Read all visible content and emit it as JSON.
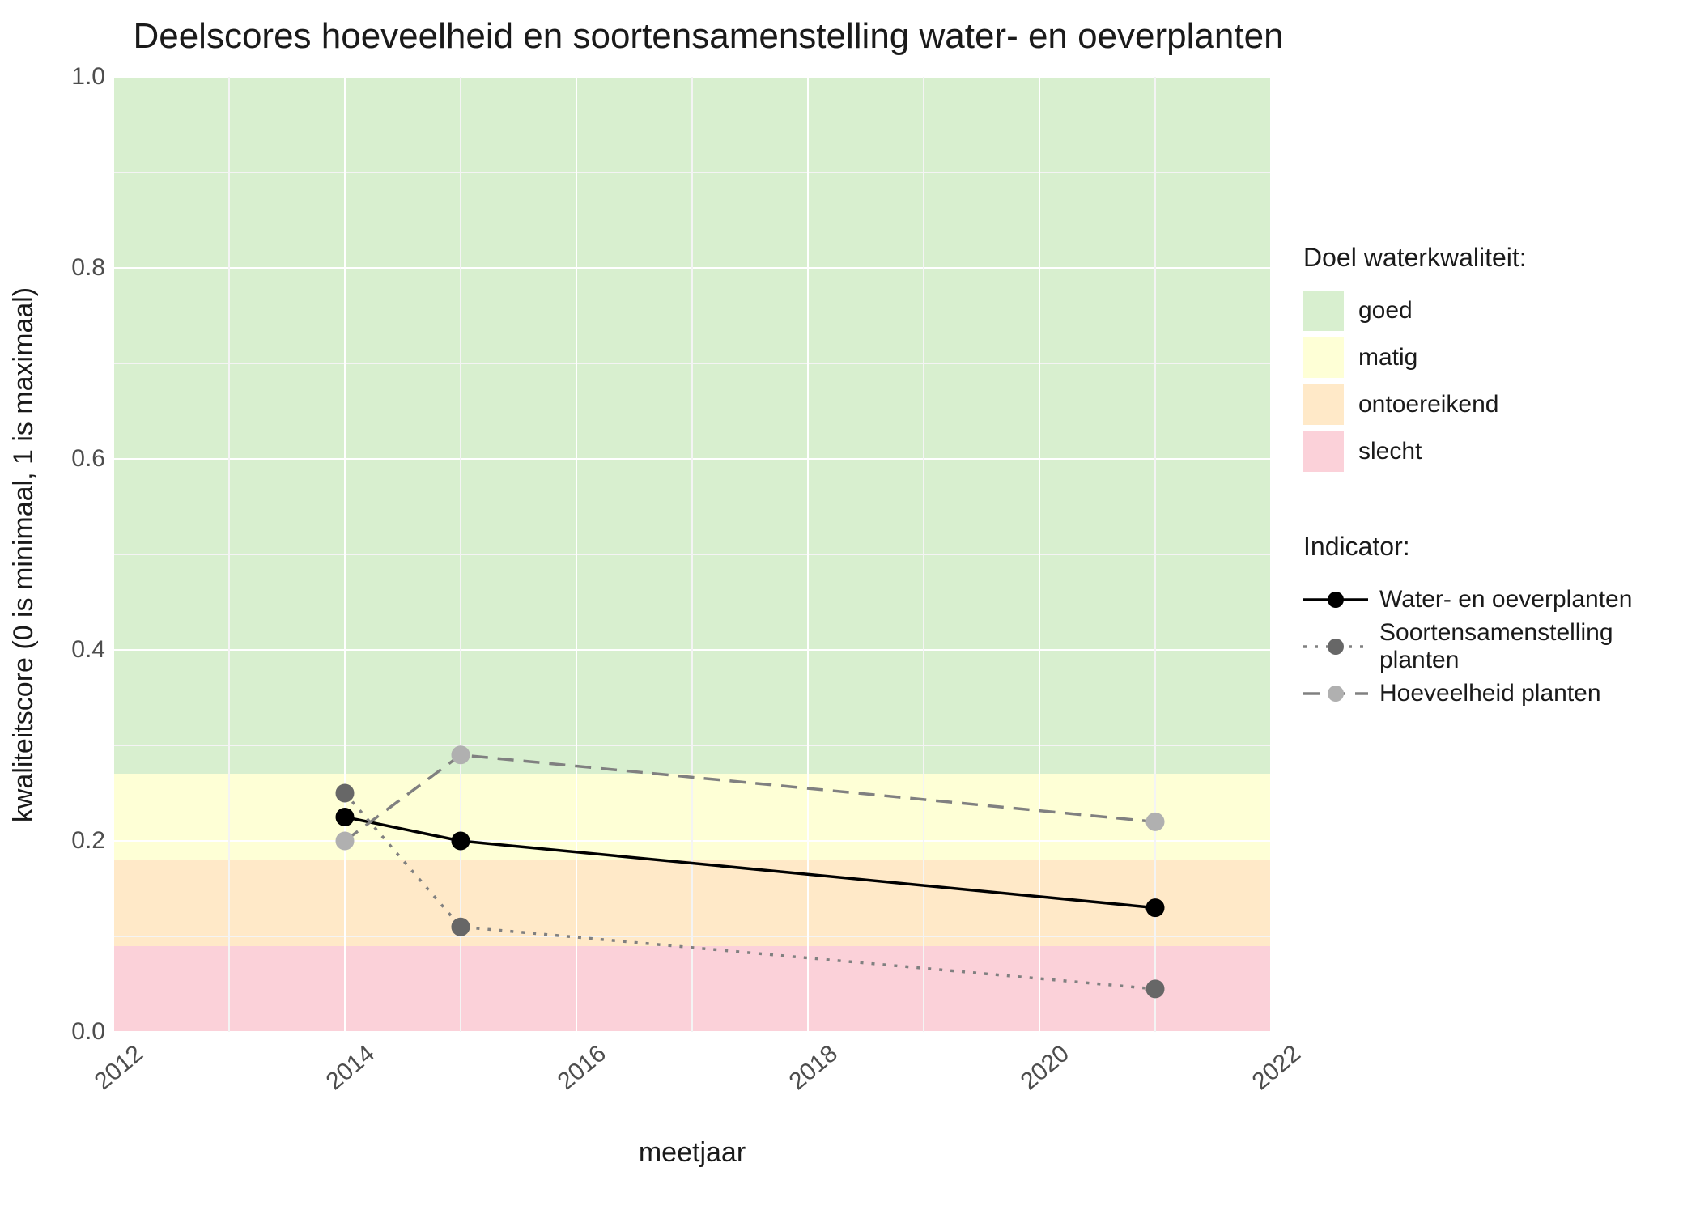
{
  "chart_data": {
    "type": "line",
    "title": "Deelscores hoeveelheid en soortensamenstelling water- en oeverplanten",
    "xlabel": "meetjaar",
    "ylabel": "kwaliteitscore (0 is minimaal, 1 is maximaal)",
    "xlim": [
      2012,
      2022
    ],
    "ylim": [
      0,
      1
    ],
    "xticks": [
      2012,
      2014,
      2016,
      2018,
      2020,
      2022
    ],
    "yticks": [
      0.0,
      0.2,
      0.4,
      0.6,
      0.8,
      1.0
    ],
    "bands_title": "Doel waterkwaliteit:",
    "bands": [
      {
        "name": "goed",
        "from": 0.27,
        "to": 1.0,
        "color": "#d8efcf"
      },
      {
        "name": "matig",
        "from": 0.18,
        "to": 0.27,
        "color": "#feffd6"
      },
      {
        "name": "ontoereikend",
        "from": 0.09,
        "to": 0.18,
        "color": "#ffe9c8"
      },
      {
        "name": "slecht",
        "from": 0.0,
        "to": 0.09,
        "color": "#fbd1d9"
      }
    ],
    "series_title": "Indicator:",
    "series": [
      {
        "name": "Water- en oeverplanten",
        "color": "#000000",
        "marker_fill": "#000000",
        "dash": "solid",
        "x": [
          2014,
          2015,
          2021
        ],
        "y": [
          0.225,
          0.2,
          0.13
        ]
      },
      {
        "name": "Soortensamenstelling planten",
        "color": "#808080",
        "marker_fill": "#676767",
        "dash": "dotted",
        "x": [
          2014,
          2015,
          2021
        ],
        "y": [
          0.25,
          0.11,
          0.045
        ]
      },
      {
        "name": "Hoeveelheid planten",
        "color": "#808080",
        "marker_fill": "#b0b0b0",
        "dash": "dashed",
        "x": [
          2014,
          2015,
          2021
        ],
        "y": [
          0.2,
          0.29,
          0.22
        ]
      }
    ]
  }
}
